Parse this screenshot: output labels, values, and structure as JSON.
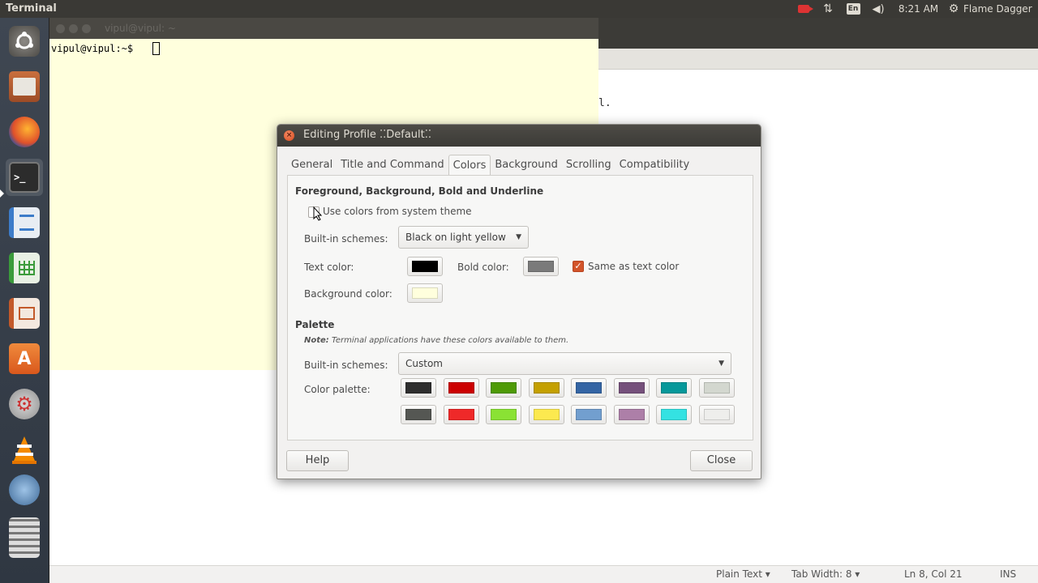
{
  "top_panel": {
    "app_title": "Terminal",
    "keyboard_layout": "En",
    "clock": "8:21 AM",
    "user": "Flame Dagger"
  },
  "launcher": {
    "items": [
      {
        "icon": "ubuntu-dash-icon"
      },
      {
        "icon": "files-icon"
      },
      {
        "icon": "firefox-icon"
      },
      {
        "icon": "terminal-icon"
      },
      {
        "icon": "writer-icon"
      },
      {
        "icon": "calc-icon"
      },
      {
        "icon": "impress-icon"
      },
      {
        "icon": "software-center-icon"
      },
      {
        "icon": "system-settings-icon"
      },
      {
        "icon": "vlc-icon"
      },
      {
        "icon": "workspace-icon"
      },
      {
        "icon": "trash-icon"
      }
    ]
  },
  "terminal": {
    "title": "vipul@vipul: ~",
    "prompt": "vipul@vipul:~$ "
  },
  "editor": {
    "snippet": "l."
  },
  "statusbar": {
    "mode": "Plain Text ▾",
    "tab_width": "Tab Width: 8 ▾",
    "position": "Ln 8, Col 21",
    "ins": "INS"
  },
  "dialog": {
    "title": "Editing Profile ⁚⁚Default⁚⁚",
    "tabs": [
      "General",
      "Title and Command",
      "Colors",
      "Background",
      "Scrolling",
      "Compatibility"
    ],
    "active_tab": "Colors",
    "fg_section_title": "Foreground, Background, Bold and Underline",
    "use_system_colors_label": "Use colors from system theme",
    "use_system_colors_checked": false,
    "builtin_schemes_label": "Built-in schemes:",
    "builtin_scheme_value": "Black on light yellow",
    "text_color_label": "Text color:",
    "text_color": "#000000",
    "bold_color_label": "Bold color:",
    "bold_color": "#7a7a7a",
    "same_as_text_label": "Same as text color",
    "same_as_text_checked": true,
    "background_color_label": "Background color:",
    "background_color": "#ffffdd",
    "palette_section_title": "Palette",
    "palette_note_bold": "Note:",
    "palette_note": " Terminal applications have these colors available to them.",
    "palette_schemes_label": "Built-in schemes:",
    "palette_scheme_value": "Custom",
    "color_palette_label": "Color palette:",
    "palette_row1": [
      "#2e2e2e",
      "#cc0000",
      "#4e9a06",
      "#c4a000",
      "#3465a4",
      "#75507b",
      "#06989a",
      "#d3d7cf"
    ],
    "palette_row2": [
      "#555753",
      "#ef2929",
      "#8ae234",
      "#fce94f",
      "#729fcf",
      "#ad7fa8",
      "#34e2e2",
      "#eeeeec"
    ],
    "help_label": "Help",
    "close_label": "Close"
  },
  "colors": {
    "panel_bg": "#3a3935",
    "accent_checkbox": "#d2542a",
    "terminal_bg": "#ffffdd"
  }
}
